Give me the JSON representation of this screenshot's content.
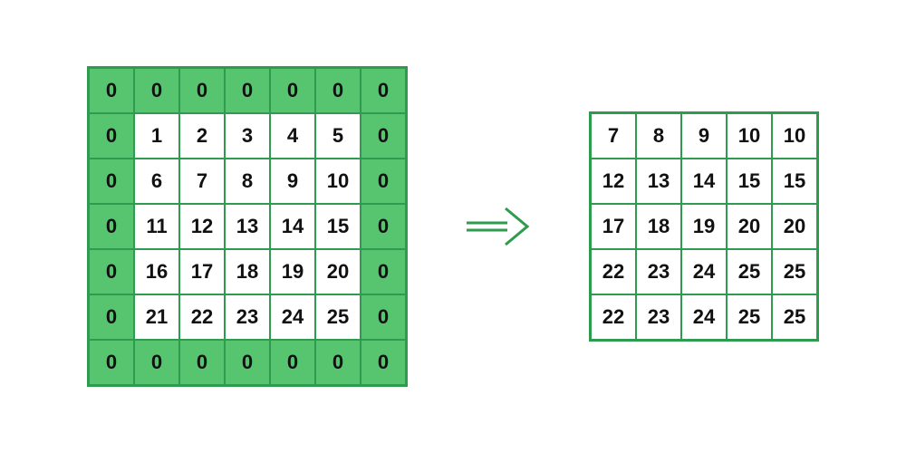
{
  "colors": {
    "border": "#2e9b4f",
    "padding_fill": "#57c570",
    "data_fill": "#ffffff",
    "text": "#111111",
    "arrow": "#2e9b4f"
  },
  "input_grid": {
    "rows": 7,
    "cols": 7,
    "cells": [
      [
        {
          "v": "0",
          "pad": true
        },
        {
          "v": "0",
          "pad": true
        },
        {
          "v": "0",
          "pad": true
        },
        {
          "v": "0",
          "pad": true
        },
        {
          "v": "0",
          "pad": true
        },
        {
          "v": "0",
          "pad": true
        },
        {
          "v": "0",
          "pad": true
        }
      ],
      [
        {
          "v": "0",
          "pad": true
        },
        {
          "v": "1",
          "pad": false
        },
        {
          "v": "2",
          "pad": false
        },
        {
          "v": "3",
          "pad": false
        },
        {
          "v": "4",
          "pad": false
        },
        {
          "v": "5",
          "pad": false
        },
        {
          "v": "0",
          "pad": true
        }
      ],
      [
        {
          "v": "0",
          "pad": true
        },
        {
          "v": "6",
          "pad": false
        },
        {
          "v": "7",
          "pad": false
        },
        {
          "v": "8",
          "pad": false
        },
        {
          "v": "9",
          "pad": false
        },
        {
          "v": "10",
          "pad": false
        },
        {
          "v": "0",
          "pad": true
        }
      ],
      [
        {
          "v": "0",
          "pad": true
        },
        {
          "v": "11",
          "pad": false
        },
        {
          "v": "12",
          "pad": false
        },
        {
          "v": "13",
          "pad": false
        },
        {
          "v": "14",
          "pad": false
        },
        {
          "v": "15",
          "pad": false
        },
        {
          "v": "0",
          "pad": true
        }
      ],
      [
        {
          "v": "0",
          "pad": true
        },
        {
          "v": "16",
          "pad": false
        },
        {
          "v": "17",
          "pad": false
        },
        {
          "v": "18",
          "pad": false
        },
        {
          "v": "19",
          "pad": false
        },
        {
          "v": "20",
          "pad": false
        },
        {
          "v": "0",
          "pad": true
        }
      ],
      [
        {
          "v": "0",
          "pad": true
        },
        {
          "v": "21",
          "pad": false
        },
        {
          "v": "22",
          "pad": false
        },
        {
          "v": "23",
          "pad": false
        },
        {
          "v": "24",
          "pad": false
        },
        {
          "v": "25",
          "pad": false
        },
        {
          "v": "0",
          "pad": true
        }
      ],
      [
        {
          "v": "0",
          "pad": true
        },
        {
          "v": "0",
          "pad": true
        },
        {
          "v": "0",
          "pad": true
        },
        {
          "v": "0",
          "pad": true
        },
        {
          "v": "0",
          "pad": true
        },
        {
          "v": "0",
          "pad": true
        },
        {
          "v": "0",
          "pad": true
        }
      ]
    ]
  },
  "output_grid": {
    "rows": 5,
    "cols": 5,
    "cells": [
      [
        {
          "v": "7"
        },
        {
          "v": "8"
        },
        {
          "v": "9"
        },
        {
          "v": "10"
        },
        {
          "v": "10"
        }
      ],
      [
        {
          "v": "12"
        },
        {
          "v": "13"
        },
        {
          "v": "14"
        },
        {
          "v": "15"
        },
        {
          "v": "15"
        }
      ],
      [
        {
          "v": "17"
        },
        {
          "v": "18"
        },
        {
          "v": "19"
        },
        {
          "v": "20"
        },
        {
          "v": "20"
        }
      ],
      [
        {
          "v": "22"
        },
        {
          "v": "23"
        },
        {
          "v": "24"
        },
        {
          "v": "25"
        },
        {
          "v": "25"
        }
      ],
      [
        {
          "v": "22"
        },
        {
          "v": "23"
        },
        {
          "v": "24"
        },
        {
          "v": "25"
        },
        {
          "v": "25"
        }
      ]
    ]
  }
}
